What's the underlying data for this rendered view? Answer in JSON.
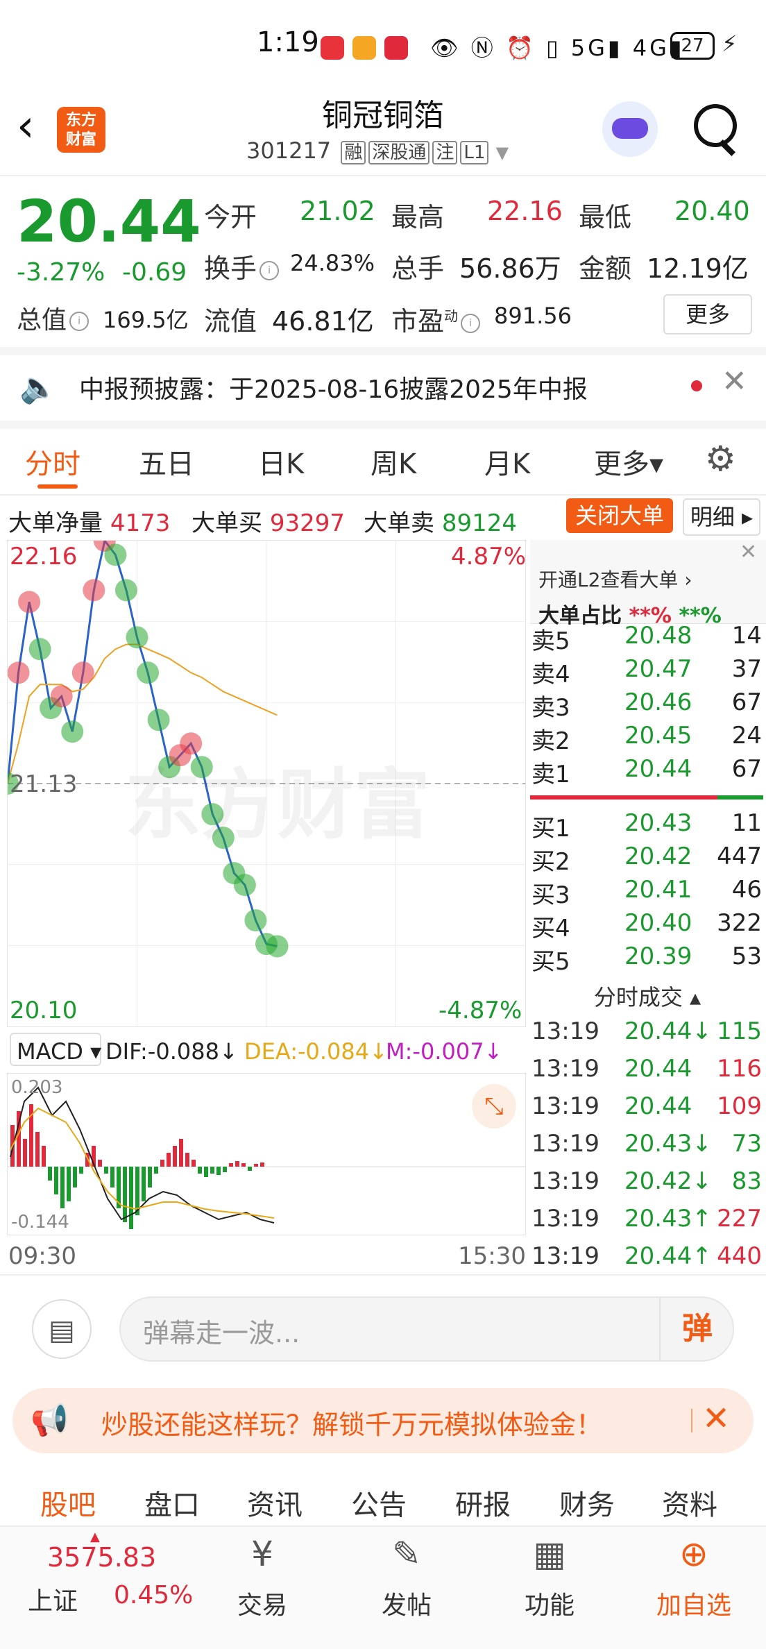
{
  "status_bar": {
    "time": "1:19",
    "icons": "👁 Ⓝ ⏰ ▯ 5G▮ 4G▮",
    "battery": "27",
    "app_icon_colors": [
      "#e8333b",
      "#f25b14",
      "#e0293a"
    ]
  },
  "header": {
    "logo_line1": "东方",
    "logo_line2": "财富",
    "title": "铜冠铜箔",
    "code": "301217",
    "tags": [
      "融",
      "深股通",
      "注",
      "L1"
    ]
  },
  "quote": {
    "price": "20.44",
    "change_pct": "-3.27%",
    "change": "-0.69",
    "open_label": "今开",
    "open": "21.02",
    "high_label": "最高",
    "high": "22.16",
    "low_label": "最低",
    "low": "20.40",
    "turnover_label": "换手",
    "turnover": "24.83%",
    "volume_label": "总手",
    "volume": "56.86万",
    "amount_label": "金额",
    "amount": "12.19亿",
    "mktcap_label": "总值",
    "mktcap": "169.5亿",
    "float_label": "流值",
    "float": "46.81亿",
    "pe_label": "市盈",
    "pe_sup": "动",
    "pe": "891.56",
    "more": "更多"
  },
  "notice": {
    "text": "中报预披露：于2025-08-16披露2025年中报"
  },
  "tabs": [
    "分时",
    "五日",
    "日K",
    "周K",
    "月K",
    "更多▾"
  ],
  "big_orders": {
    "net_label": "大单净量",
    "net": "4173",
    "buy_label": "大单买",
    "buy": "93297",
    "sell_label": "大单卖",
    "sell": "89124",
    "close_btn": "关闭大单",
    "detail_btn": "明细 ▸"
  },
  "chart_labels": {
    "high": "22.16",
    "mid": "21.13",
    "low": "20.10",
    "pct_high": "4.87%",
    "pct_low": "-4.87%",
    "time_start": "09:30",
    "time_end": "15:30",
    "watermark": "东方财富"
  },
  "chart_data": {
    "type": "line",
    "title": "",
    "ylim": [
      20.1,
      22.16
    ],
    "x": [
      0,
      5,
      10,
      15,
      20,
      25,
      30,
      35,
      40,
      45,
      50,
      55,
      60,
      65,
      70,
      75,
      80,
      85,
      90,
      95,
      100,
      105,
      110,
      115,
      120,
      125
    ],
    "series": [
      {
        "values": [
          21.13,
          21.6,
          21.9,
          21.7,
          21.45,
          21.5,
          21.35,
          21.6,
          21.95,
          22.16,
          22.1,
          21.95,
          21.75,
          21.6,
          21.4,
          21.2,
          21.25,
          21.3,
          21.2,
          21.0,
          20.9,
          20.75,
          20.7,
          20.55,
          20.45,
          20.44
        ]
      },
      {
        "values": [
          21.13,
          21.3,
          21.5,
          21.55,
          21.55,
          21.55,
          21.52,
          21.53,
          21.58,
          21.66,
          21.7,
          21.72,
          21.72,
          21.7,
          21.68,
          21.66,
          21.63,
          21.6,
          21.58,
          21.55,
          21.52,
          21.5,
          21.48,
          21.46,
          21.44,
          21.42
        ]
      }
    ]
  },
  "order_book": {
    "l2_text": "开通L2查看大单 ›",
    "share_label": "大单占比",
    "share_buy": "**%",
    "share_sell": "**%",
    "asks": [
      {
        "label": "卖5",
        "price": "20.48",
        "vol": "14"
      },
      {
        "label": "卖4",
        "price": "20.47",
        "vol": "37"
      },
      {
        "label": "卖3",
        "price": "20.46",
        "vol": "67"
      },
      {
        "label": "卖2",
        "price": "20.45",
        "vol": "24"
      },
      {
        "label": "卖1",
        "price": "20.44",
        "vol": "67"
      }
    ],
    "bids": [
      {
        "label": "买1",
        "price": "20.43",
        "vol": "11"
      },
      {
        "label": "买2",
        "price": "20.42",
        "vol": "447"
      },
      {
        "label": "买3",
        "price": "20.41",
        "vol": "46"
      },
      {
        "label": "买4",
        "price": "20.40",
        "vol": "322"
      },
      {
        "label": "买5",
        "price": "20.39",
        "vol": "53"
      }
    ]
  },
  "macd": {
    "label": "MACD ▾",
    "dif": "DIF:-0.088↓",
    "dea": "DEA:-0.084↓",
    "m": "M:-0.007↓",
    "top": "0.203",
    "bottom": "-0.144"
  },
  "ticks": {
    "header": "分时成交 ▴",
    "rows": [
      {
        "time": "13:19",
        "price": "20.44↓",
        "vol": "115",
        "color": "#1a9a2e"
      },
      {
        "time": "13:19",
        "price": "20.44",
        "vol": "116",
        "color": "#e0293a"
      },
      {
        "time": "13:19",
        "price": "20.44",
        "vol": "109",
        "color": "#e0293a"
      },
      {
        "time": "13:19",
        "price": "20.43↓",
        "vol": "73",
        "color": "#1a9a2e"
      },
      {
        "time": "13:19",
        "price": "20.42↓",
        "vol": "83",
        "color": "#1a9a2e"
      },
      {
        "time": "13:19",
        "price": "20.43↑",
        "vol": "227",
        "color": "#e0293a"
      },
      {
        "time": "13:19",
        "price": "20.44↑",
        "vol": "440",
        "color": "#e0293a"
      }
    ]
  },
  "danmu": {
    "placeholder": "弹幕走一波...",
    "btn": "弹"
  },
  "promo": {
    "text": "炒股还能这样玩？解锁千万元模拟体验金！"
  },
  "sub_tabs": [
    "股吧",
    "盘口",
    "资讯",
    "公告",
    "研报",
    "财务",
    "资料"
  ],
  "bottom_nav": {
    "index_value": "3575.83",
    "index_name": "上证",
    "index_pct": "0.45%",
    "items": [
      {
        "icon": "¥",
        "label": "交易"
      },
      {
        "icon": "✎",
        "label": "发帖"
      },
      {
        "icon": "▦",
        "label": "功能"
      },
      {
        "icon": "⊕",
        "label": "加自选"
      }
    ]
  },
  "colors": {
    "accent": "#f25b14",
    "up": "#e0293a",
    "down": "#1a9a2e"
  }
}
